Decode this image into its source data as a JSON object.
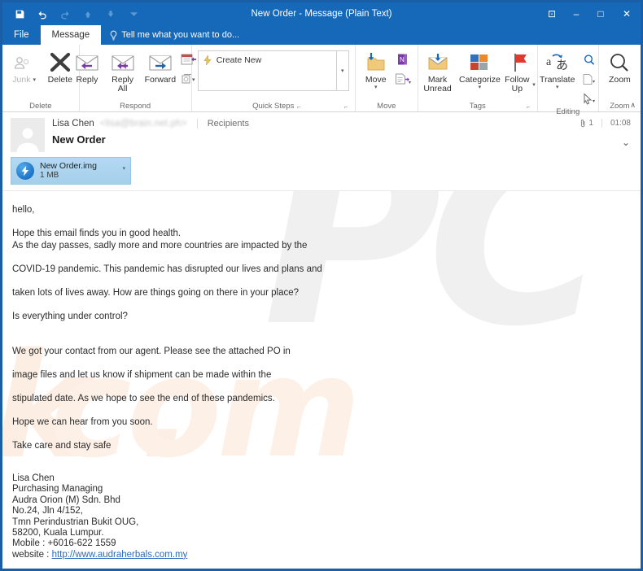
{
  "window": {
    "title": "New Order - Message (Plain Text)",
    "quick_access": [
      {
        "name": "save",
        "icon": "save-icon",
        "enabled": true
      },
      {
        "name": "undo",
        "icon": "undo-icon",
        "enabled": true
      },
      {
        "name": "redo",
        "icon": "redo-icon",
        "enabled": false
      },
      {
        "name": "previous-item",
        "icon": "up-arrow-icon",
        "enabled": false
      },
      {
        "name": "next-item",
        "icon": "down-arrow-icon",
        "enabled": false
      },
      {
        "name": "customize-quick-access-toolbar",
        "icon": "chevron-down-icon",
        "enabled": false
      }
    ],
    "controls": {
      "ribbon_display": "⊡",
      "minimize": "–",
      "maximize": "□",
      "close": "✕"
    }
  },
  "tabs": {
    "file": "File",
    "message": "Message",
    "tellme": "Tell me what you want to do..."
  },
  "ribbon": {
    "groups": [
      {
        "label": "Delete",
        "buttons": [
          {
            "label": "Junk",
            "icon": "junk-people-icon",
            "disabled": true,
            "has_caret": true
          },
          {
            "label": "Delete",
            "icon": "delete-x-icon",
            "disabled": false,
            "has_caret": false
          }
        ]
      },
      {
        "label": "Respond",
        "buttons": [
          {
            "label": "Reply",
            "icon": "reply-envelope-icon",
            "disabled": false,
            "has_caret": false
          },
          {
            "label": "Reply All",
            "icon": "reply-all-envelope-icon",
            "disabled": false,
            "has_caret": false
          },
          {
            "label": "Forward",
            "icon": "forward-envelope-icon",
            "disabled": false,
            "has_caret": false
          }
        ],
        "small_buttons": [
          {
            "name": "meeting",
            "icon": "meeting-calendar-icon"
          },
          {
            "name": "more-respond",
            "icon": "more-actions-icon",
            "has_caret": true
          }
        ]
      },
      {
        "label": "Quick Steps",
        "gallery_items": [
          {
            "label": "Create New",
            "icon": "quick-step-lightning-icon"
          }
        ],
        "scroll": "▾",
        "has_dialog_launcher": true
      },
      {
        "label": "Move",
        "buttons": [
          {
            "label": "Move",
            "icon": "move-folder-icon",
            "disabled": false,
            "has_caret": true
          }
        ],
        "small_buttons": [
          {
            "name": "onenote",
            "icon": "onenote-icon"
          },
          {
            "name": "rules",
            "icon": "rules-page-icon",
            "has_caret": true
          }
        ],
        "has_dialog_launcher": true
      },
      {
        "label": "Tags",
        "buttons": [
          {
            "label": "Mark Unread",
            "icon": "mark-unread-envelope-icon",
            "disabled": false,
            "has_caret": false
          },
          {
            "label": "Categorize",
            "icon": "categorize-squares-icon",
            "disabled": false,
            "has_caret": true
          },
          {
            "label": "Follow Up",
            "icon": "follow-up-flag-icon",
            "disabled": false,
            "has_caret": true
          }
        ],
        "has_dialog_launcher": true
      },
      {
        "label": "Editing",
        "buttons": [
          {
            "label": "Translate",
            "icon": "translate-icon",
            "disabled": false,
            "has_caret": true
          }
        ],
        "small_buttons": [
          {
            "name": "find",
            "icon": "find-magnifier-icon"
          },
          {
            "name": "select",
            "icon": "select-page-icon",
            "has_caret": true
          },
          {
            "name": "pointer",
            "icon": "pointer-cursor-icon",
            "has_caret": true
          }
        ]
      },
      {
        "label": "Zoom",
        "buttons": [
          {
            "label": "Zoom",
            "icon": "zoom-magnifier-icon",
            "disabled": false,
            "has_caret": false
          }
        ]
      }
    ],
    "collapse": "∧"
  },
  "message": {
    "sender_name": "Lisa Chen",
    "sender_email": "<lisa@brain.net.ph>",
    "recipients_label": "Recipients",
    "subject": "New Order",
    "attachment_count": "1",
    "time": "01:08",
    "expand_caret": "⌄",
    "attachment": {
      "name": "New Order.img",
      "size": "1 MB",
      "caret": "▾"
    },
    "body_lines": [
      {
        "text": "hello,",
        "gap_after": "m"
      },
      {
        "text": "Hope this email finds you in good health.",
        "gap_after": ""
      },
      {
        "text": "As the day passes, sadly more and more countries are impacted by the",
        "gap_after": "m"
      },
      {
        "text": "COVID-19 pandemic. This pandemic has disrupted our lives and plans and",
        "gap_after": "m"
      },
      {
        "text": "taken lots of lives away. How are things going on there in your place?",
        "gap_after": "m"
      },
      {
        "text": "Is everything under control?",
        "gap_after": "m"
      },
      {
        "text": "",
        "gap_after": "s"
      },
      {
        "text": "We got your contact from our agent. Please see the attached PO in",
        "gap_after": "m"
      },
      {
        "text": "image files and let us know if shipment can be made within the",
        "gap_after": "m"
      },
      {
        "text": "stipulated date. As we hope to see the end of these pandemics.",
        "gap_after": "m"
      },
      {
        "text": "Hope we can hear from you soon.",
        "gap_after": "m"
      },
      {
        "text": "Take care and stay safe",
        "gap_after": ""
      }
    ],
    "signature_lines": [
      "Lisa Chen",
      "Purchasing Managing",
      "Audra Orion (M) Sdn. Bhd",
      "No.24, Jln 4/152,",
      "Tmn Perindustrian Bukit OUG,",
      "58200, Kuala Lumpur.",
      "Mobile : +6016-622 1559"
    ],
    "website_label": "website : ",
    "website_url": "http://www.audraherbals.com.my"
  },
  "watermark": {
    "primary": "PC",
    "secondary": "com",
    "tertiary": "k ."
  },
  "colors": {
    "titlebar": "#1668b8",
    "window_border": "#1a5ea8",
    "attachment_chip": "#a9d4ef",
    "link": "#2a6bbd",
    "accent_purple": "#7a3aa8",
    "accent_blue": "#1d72c4"
  }
}
